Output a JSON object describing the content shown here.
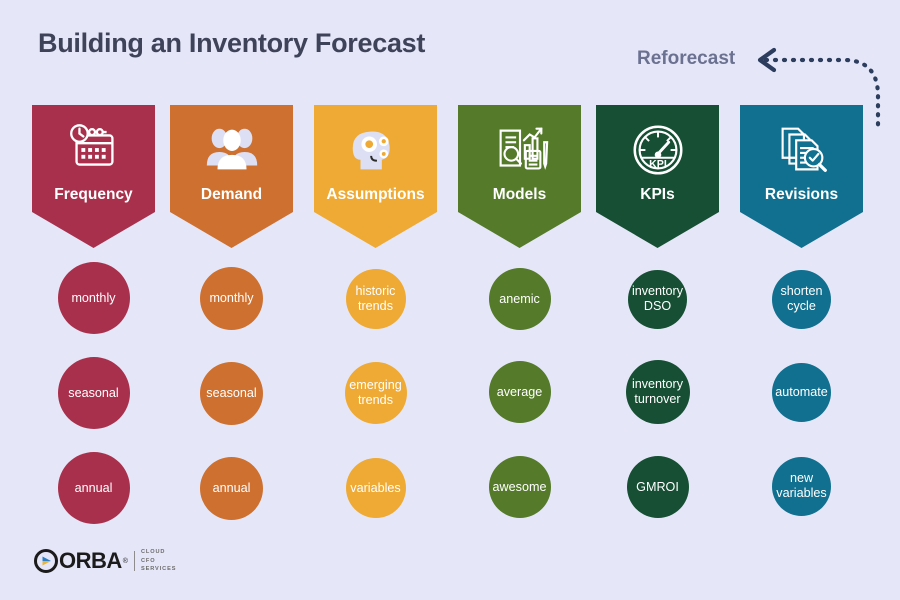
{
  "theme": {
    "background": "#e5e7f8",
    "title_color": "#3f4359",
    "annotation_color": "#6b7190",
    "arrow_color": "#2d3d5e"
  },
  "header": {
    "title": "Building an Inventory Forecast"
  },
  "annotation": {
    "label": "Reforecast",
    "arrow_icon": "dashed-curved-arrow-left-icon"
  },
  "columns": [
    {
      "id": "frequency",
      "label": "Frequency",
      "color": "#a8304c",
      "circle_color": "#a8304c",
      "icon": "calendar-clock-icon",
      "items": [
        {
          "label": "monthly",
          "size": 72
        },
        {
          "label": "seasonal",
          "size": 72
        },
        {
          "label": "annual",
          "size": 72
        }
      ]
    },
    {
      "id": "demand",
      "label": "Demand",
      "color": "#cd7030",
      "circle_color": "#cd7030",
      "icon": "people-group-icon",
      "items": [
        {
          "label": "monthly",
          "size": 62
        },
        {
          "label": "seasonal",
          "size": 62
        },
        {
          "label": "annual",
          "size": 62
        }
      ]
    },
    {
      "id": "assumptions",
      "label": "Assumptions",
      "color": "#eeaa34",
      "circle_color": "#eeaa34",
      "icon": "head-gears-icon",
      "items": [
        {
          "label": "historic trends",
          "size": 58
        },
        {
          "label": "emerging trends",
          "size": 62
        },
        {
          "label": "variables",
          "size": 58
        }
      ]
    },
    {
      "id": "models",
      "label": "Models",
      "color": "#547a2a",
      "circle_color": "#547a2a",
      "icon": "report-chart-calculator-icon",
      "items": [
        {
          "label": "anemic",
          "size": 62
        },
        {
          "label": "average",
          "size": 62
        },
        {
          "label": "awesome",
          "size": 62
        }
      ]
    },
    {
      "id": "kpis",
      "label": "KPIs",
      "color": "#164f33",
      "circle_color": "#164f33",
      "icon": "kpi-gauge-icon",
      "items": [
        {
          "label": "inventory DSO",
          "size": 58
        },
        {
          "label": "inventory turnover",
          "size": 62
        },
        {
          "label": "GMROI",
          "size": 62
        }
      ]
    },
    {
      "id": "revisions",
      "label": "Revisions",
      "color": "#11708f",
      "circle_color": "#11708f",
      "icon": "documents-search-icon",
      "items": [
        {
          "label": "shorten cycle",
          "size": 58
        },
        {
          "label": "automate",
          "size": 58
        },
        {
          "label": "new variables",
          "size": 58
        }
      ]
    }
  ],
  "logo": {
    "wordmark": "ORBA",
    "registered": "®",
    "tagline_lines": [
      "CLOUD",
      "CFO",
      "SERVICES"
    ],
    "mark_icon": "orba-play-circle-icon"
  }
}
